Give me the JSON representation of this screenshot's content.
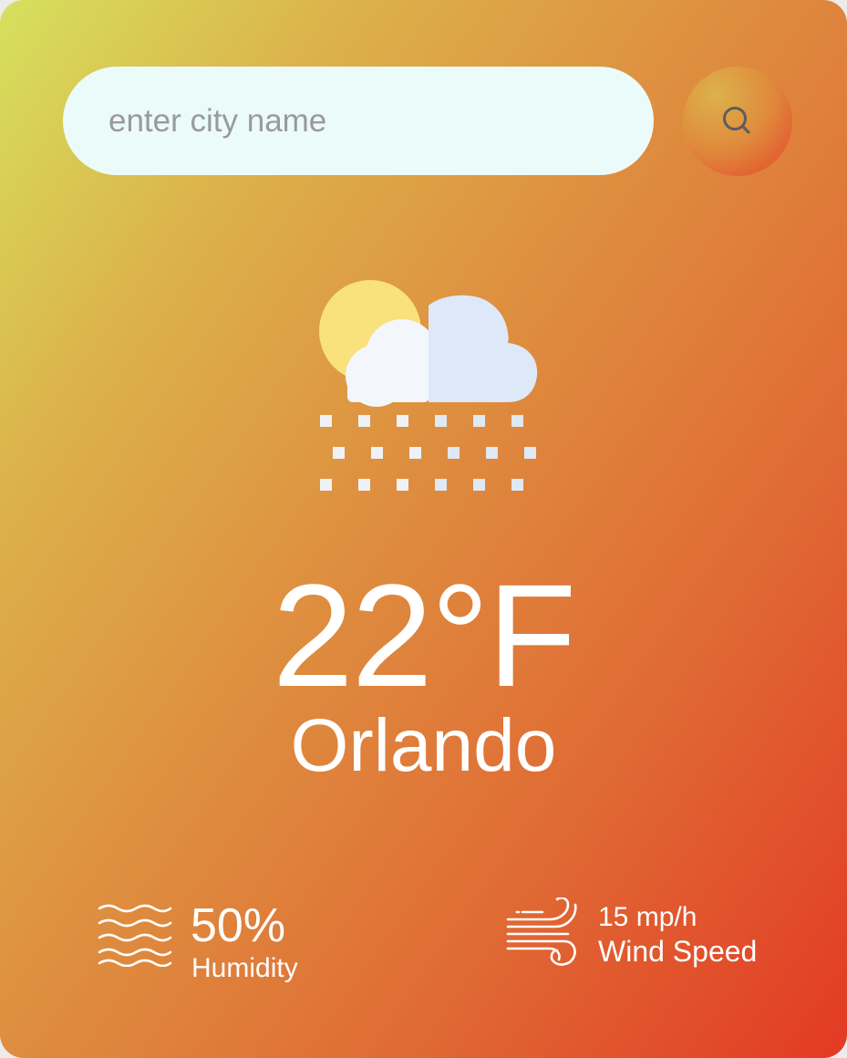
{
  "search": {
    "placeholder": "enter city name",
    "value": "",
    "button_icon": "search-icon"
  },
  "weather": {
    "icon": "partly-cloudy-snow-icon",
    "temperature": "22°F",
    "city": "Orlando"
  },
  "details": {
    "humidity": {
      "icon": "humidity-waves-icon",
      "value": "50%",
      "label": "Humidity"
    },
    "wind": {
      "icon": "wind-icon",
      "value": "15 mp/h",
      "label": "Wind Speed"
    }
  },
  "colors": {
    "gradient_start": "#d6e05e",
    "gradient_mid": "#de9040",
    "gradient_end": "#e23a24",
    "input_background": "#ebfbfa",
    "text": "#ffffff"
  }
}
